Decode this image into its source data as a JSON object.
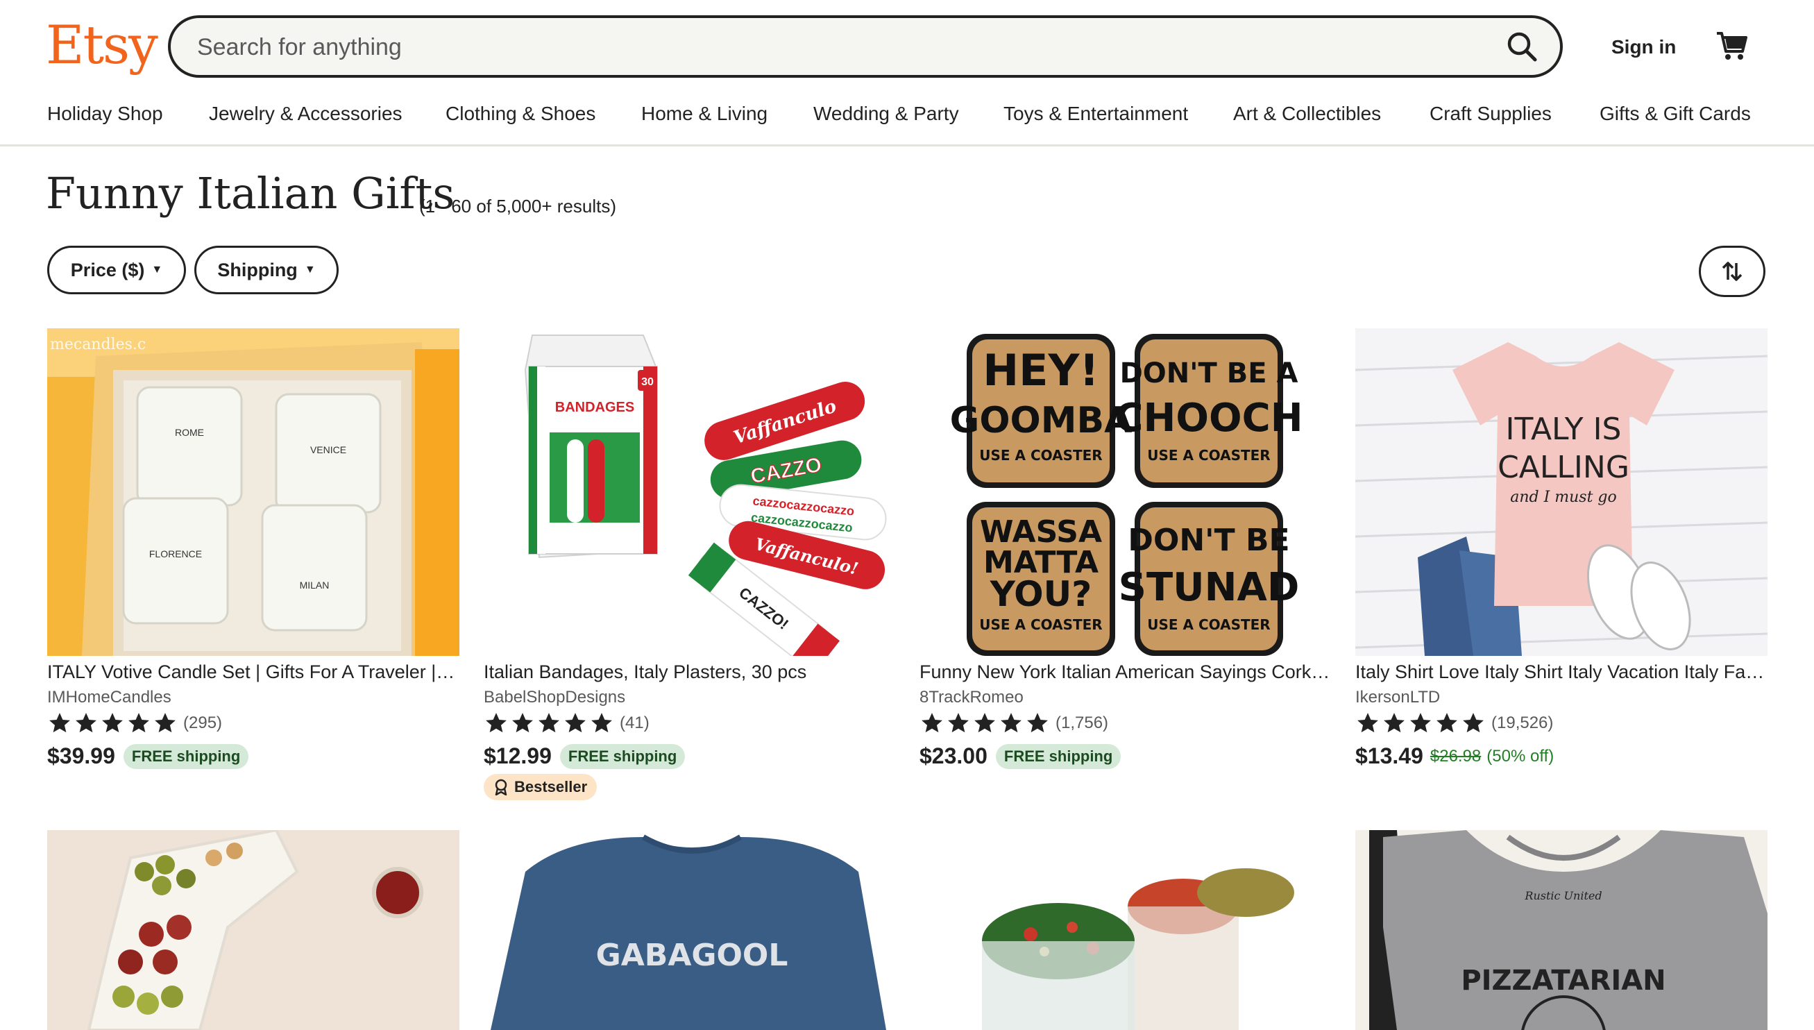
{
  "brand": {
    "logo_text": "Etsy",
    "accent_color": "#f1641e"
  },
  "search": {
    "placeholder": "Search for anything",
    "value": ""
  },
  "header": {
    "sign_in": "Sign in",
    "cart_icon": "shopping-cart-icon"
  },
  "nav": {
    "items": [
      "Holiday Shop",
      "Jewelry & Accessories",
      "Clothing & Shoes",
      "Home & Living",
      "Wedding & Party",
      "Toys & Entertainment",
      "Art & Collectibles",
      "Craft Supplies",
      "Gifts & Gift Cards"
    ]
  },
  "results": {
    "title": "Funny Italian Gifts",
    "count_text": "(1 - 60 of 5,000+ results)"
  },
  "filters": {
    "price_label": "Price ($)",
    "shipping_label": "Shipping",
    "sort_icon": "sort-arrows-icon"
  },
  "listings": [
    {
      "title": "ITALY Votive Candle Set | Gifts For A Traveler | Italian Gifts",
      "shop": "IMHomeCandles",
      "reviews": "(295)",
      "rating": 5,
      "price": "$39.99",
      "free_shipping": "FREE shipping",
      "image_text": {
        "top": "mecandles.c",
        "c1": "ROME",
        "c2": "VENICE",
        "c3": "FLORENCE",
        "c4": "MILAN"
      }
    },
    {
      "title": "Italian Bandages, Italy Plasters, 30 pcs",
      "shop": "BabelShopDesigns",
      "reviews": "(41)",
      "rating": 5,
      "price": "$12.99",
      "free_shipping": "FREE shipping",
      "badge": "Bestseller",
      "image_text": {
        "box": "BANDAGES",
        "count": "30",
        "b1": "Vaffanculo",
        "b2": "CAZZO",
        "b3": "cazzocazzocazzo",
        "b4": "Vaffanculo!",
        "b5": "CAZZO!"
      }
    },
    {
      "title": "Funny New York Italian American Sayings Cork Coasters",
      "shop": "8TrackRomeo",
      "reviews": "(1,756)",
      "rating": 5,
      "price": "$23.00",
      "free_shipping": "FREE shipping",
      "image_text": {
        "c1a": "HEY!",
        "c1b": "GOOMBA",
        "c2a": "DON'T BE A",
        "c2b": "CHOOCH",
        "c3a": "WASSA",
        "c3b": "MATTA",
        "c3c": "YOU?",
        "c4a": "DON'T BE",
        "c4b": "STUNAD",
        "sub": "USE A COASTER"
      }
    },
    {
      "title": "Italy Shirt Love Italy Shirt Italy Vacation Italy Family Shirt",
      "shop": "IkersonLTD",
      "reviews": "(19,526)",
      "rating": 5,
      "price": "$13.49",
      "original_price": "$26.98",
      "discount": "(50% off)",
      "image_text": {
        "l1": "ITALY IS",
        "l2": "CALLING",
        "l3": "and I must go"
      }
    }
  ],
  "second_row_images": [
    {
      "kind": "italy-shaped-tray"
    },
    {
      "kind": "sweatshirt",
      "text": "GABAGOOL"
    },
    {
      "kind": "spice-jars"
    },
    {
      "kind": "tshirt",
      "text": "PIZZATARIAN",
      "tag": "Rustic United"
    }
  ]
}
